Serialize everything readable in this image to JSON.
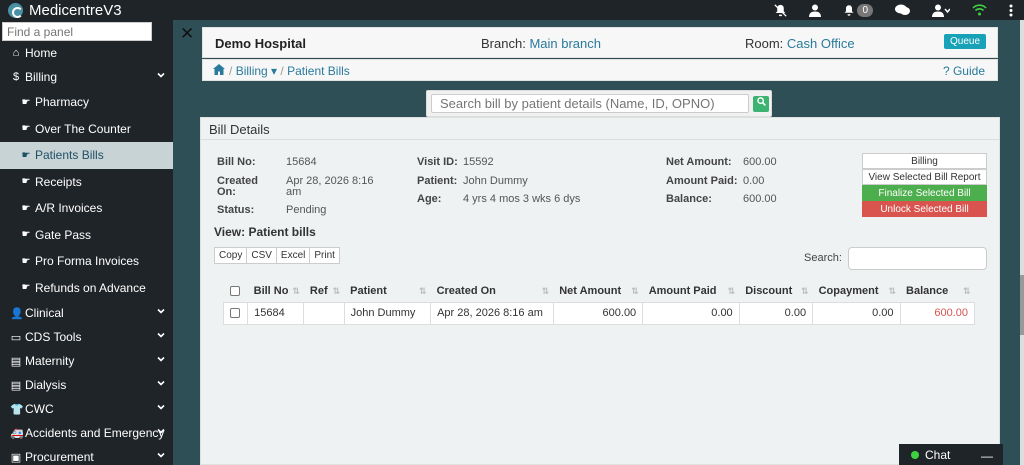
{
  "app": {
    "title": "MedicentreV3"
  },
  "topbar": {
    "notifications_count": "0"
  },
  "sidebar": {
    "find_placeholder": "Find a panel",
    "home": "Home",
    "billing": "Billing",
    "billing_items": [
      "Pharmacy",
      "Over The Counter",
      "Patients Bills",
      "Receipts",
      "A/R Invoices",
      "Gate Pass",
      "Pro Forma Invoices",
      "Refunds on Advance"
    ],
    "sections": [
      "Clinical",
      "CDS Tools",
      "Maternity",
      "Dialysis",
      "CWC",
      "Accidents and Emergency",
      "Procurement"
    ]
  },
  "header": {
    "hospital": "Demo Hospital",
    "branch_label": "Branch:",
    "branch_value": "Main branch",
    "room_label": "Room:",
    "room_value": "Cash Office",
    "queue_button": "Queue"
  },
  "breadcrumb": {
    "billing": "Billing",
    "current": "Patient Bills",
    "guide": "Guide"
  },
  "search": {
    "placeholder": "Search bill by patient details (Name, ID, OPNO)"
  },
  "bill": {
    "panel_title": "Bill Details",
    "bill_no_label": "Bill No:",
    "bill_no": "15684",
    "created_label_1": "Created",
    "created_label_2": "On:",
    "created_1": "Apr 28, 2026 8:16",
    "created_2": "am",
    "status_label": "Status:",
    "status": "Pending",
    "visit_label": "Visit ID:",
    "visit": "15592",
    "patient_label": "Patient:",
    "patient": "John Dummy",
    "age_label": "Age:",
    "age": "4 yrs 4 mos 3 wks 6 dys",
    "net_label": "Net Amount:",
    "net": "600.00",
    "paid_label": "Amount Paid:",
    "paid": "0.00",
    "balance_label": "Balance:",
    "balance": "600.00"
  },
  "actions": {
    "billing": "Billing",
    "view_report": "View Selected Bill Report",
    "finalize": "Finalize Selected Bill",
    "unlock": "Unlock Selected Bill"
  },
  "table": {
    "view_title": "View: Patient bills",
    "exports": [
      "Copy",
      "CSV",
      "Excel",
      "Print"
    ],
    "search_label": "Search:",
    "headers": [
      "Bill No",
      "Ref",
      "Patient",
      "Created On",
      "Net Amount",
      "Amount Paid",
      "Discount",
      "Copayment",
      "Balance"
    ],
    "rows": [
      [
        "15684",
        "",
        "John Dummy",
        "Apr 28, 2026 8:16 am",
        "600.00",
        "0.00",
        "0.00",
        "0.00",
        "600.00"
      ]
    ]
  },
  "chat": {
    "label": "Chat"
  }
}
